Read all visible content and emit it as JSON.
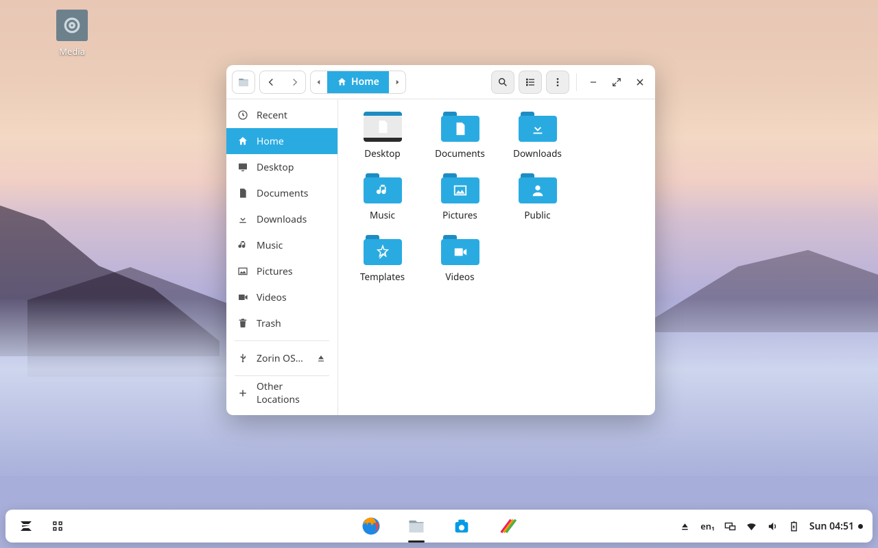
{
  "desktop": {
    "media_label": "Media"
  },
  "fm": {
    "path_label": "Home",
    "sidebar": {
      "recent": "Recent",
      "home": "Home",
      "desktop": "Desktop",
      "documents": "Documents",
      "downloads": "Downloads",
      "music": "Music",
      "pictures": "Pictures",
      "videos": "Videos",
      "trash": "Trash",
      "zorin": "Zorin OS…",
      "other": "Other Locations"
    },
    "folders": {
      "desktop": "Desktop",
      "documents": "Documents",
      "downloads": "Downloads",
      "music": "Music",
      "pictures": "Pictures",
      "public": "Public",
      "templates": "Templates",
      "videos": "Videos"
    }
  },
  "taskbar": {
    "lang": "en₁",
    "clock": "Sun 04:51"
  }
}
